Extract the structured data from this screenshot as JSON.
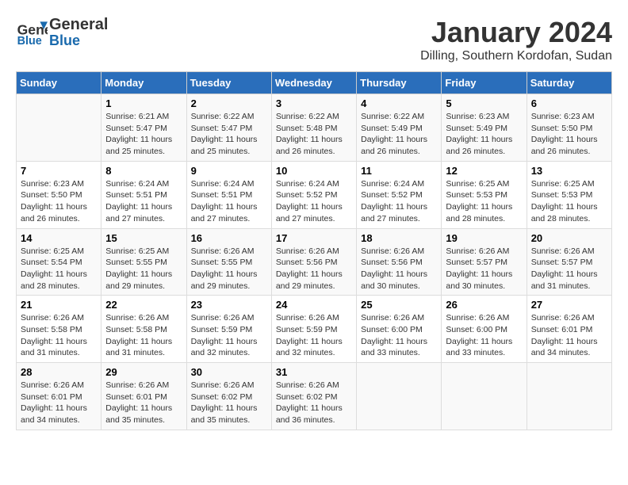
{
  "header": {
    "logo_line1": "General",
    "logo_line2": "Blue",
    "month": "January 2024",
    "location": "Dilling, Southern Kordofan, Sudan"
  },
  "days_of_week": [
    "Sunday",
    "Monday",
    "Tuesday",
    "Wednesday",
    "Thursday",
    "Friday",
    "Saturday"
  ],
  "weeks": [
    [
      {
        "day": "",
        "info": ""
      },
      {
        "day": "1",
        "info": "Sunrise: 6:21 AM\nSunset: 5:47 PM\nDaylight: 11 hours\nand 25 minutes."
      },
      {
        "day": "2",
        "info": "Sunrise: 6:22 AM\nSunset: 5:47 PM\nDaylight: 11 hours\nand 25 minutes."
      },
      {
        "day": "3",
        "info": "Sunrise: 6:22 AM\nSunset: 5:48 PM\nDaylight: 11 hours\nand 26 minutes."
      },
      {
        "day": "4",
        "info": "Sunrise: 6:22 AM\nSunset: 5:49 PM\nDaylight: 11 hours\nand 26 minutes."
      },
      {
        "day": "5",
        "info": "Sunrise: 6:23 AM\nSunset: 5:49 PM\nDaylight: 11 hours\nand 26 minutes."
      },
      {
        "day": "6",
        "info": "Sunrise: 6:23 AM\nSunset: 5:50 PM\nDaylight: 11 hours\nand 26 minutes."
      }
    ],
    [
      {
        "day": "7",
        "info": "Sunrise: 6:23 AM\nSunset: 5:50 PM\nDaylight: 11 hours\nand 26 minutes."
      },
      {
        "day": "8",
        "info": "Sunrise: 6:24 AM\nSunset: 5:51 PM\nDaylight: 11 hours\nand 27 minutes."
      },
      {
        "day": "9",
        "info": "Sunrise: 6:24 AM\nSunset: 5:51 PM\nDaylight: 11 hours\nand 27 minutes."
      },
      {
        "day": "10",
        "info": "Sunrise: 6:24 AM\nSunset: 5:52 PM\nDaylight: 11 hours\nand 27 minutes."
      },
      {
        "day": "11",
        "info": "Sunrise: 6:24 AM\nSunset: 5:52 PM\nDaylight: 11 hours\nand 27 minutes."
      },
      {
        "day": "12",
        "info": "Sunrise: 6:25 AM\nSunset: 5:53 PM\nDaylight: 11 hours\nand 28 minutes."
      },
      {
        "day": "13",
        "info": "Sunrise: 6:25 AM\nSunset: 5:53 PM\nDaylight: 11 hours\nand 28 minutes."
      }
    ],
    [
      {
        "day": "14",
        "info": "Sunrise: 6:25 AM\nSunset: 5:54 PM\nDaylight: 11 hours\nand 28 minutes."
      },
      {
        "day": "15",
        "info": "Sunrise: 6:25 AM\nSunset: 5:55 PM\nDaylight: 11 hours\nand 29 minutes."
      },
      {
        "day": "16",
        "info": "Sunrise: 6:26 AM\nSunset: 5:55 PM\nDaylight: 11 hours\nand 29 minutes."
      },
      {
        "day": "17",
        "info": "Sunrise: 6:26 AM\nSunset: 5:56 PM\nDaylight: 11 hours\nand 29 minutes."
      },
      {
        "day": "18",
        "info": "Sunrise: 6:26 AM\nSunset: 5:56 PM\nDaylight: 11 hours\nand 30 minutes."
      },
      {
        "day": "19",
        "info": "Sunrise: 6:26 AM\nSunset: 5:57 PM\nDaylight: 11 hours\nand 30 minutes."
      },
      {
        "day": "20",
        "info": "Sunrise: 6:26 AM\nSunset: 5:57 PM\nDaylight: 11 hours\nand 31 minutes."
      }
    ],
    [
      {
        "day": "21",
        "info": "Sunrise: 6:26 AM\nSunset: 5:58 PM\nDaylight: 11 hours\nand 31 minutes."
      },
      {
        "day": "22",
        "info": "Sunrise: 6:26 AM\nSunset: 5:58 PM\nDaylight: 11 hours\nand 31 minutes."
      },
      {
        "day": "23",
        "info": "Sunrise: 6:26 AM\nSunset: 5:59 PM\nDaylight: 11 hours\nand 32 minutes."
      },
      {
        "day": "24",
        "info": "Sunrise: 6:26 AM\nSunset: 5:59 PM\nDaylight: 11 hours\nand 32 minutes."
      },
      {
        "day": "25",
        "info": "Sunrise: 6:26 AM\nSunset: 6:00 PM\nDaylight: 11 hours\nand 33 minutes."
      },
      {
        "day": "26",
        "info": "Sunrise: 6:26 AM\nSunset: 6:00 PM\nDaylight: 11 hours\nand 33 minutes."
      },
      {
        "day": "27",
        "info": "Sunrise: 6:26 AM\nSunset: 6:01 PM\nDaylight: 11 hours\nand 34 minutes."
      }
    ],
    [
      {
        "day": "28",
        "info": "Sunrise: 6:26 AM\nSunset: 6:01 PM\nDaylight: 11 hours\nand 34 minutes."
      },
      {
        "day": "29",
        "info": "Sunrise: 6:26 AM\nSunset: 6:01 PM\nDaylight: 11 hours\nand 35 minutes."
      },
      {
        "day": "30",
        "info": "Sunrise: 6:26 AM\nSunset: 6:02 PM\nDaylight: 11 hours\nand 35 minutes."
      },
      {
        "day": "31",
        "info": "Sunrise: 6:26 AM\nSunset: 6:02 PM\nDaylight: 11 hours\nand 36 minutes."
      },
      {
        "day": "",
        "info": ""
      },
      {
        "day": "",
        "info": ""
      },
      {
        "day": "",
        "info": ""
      }
    ]
  ]
}
